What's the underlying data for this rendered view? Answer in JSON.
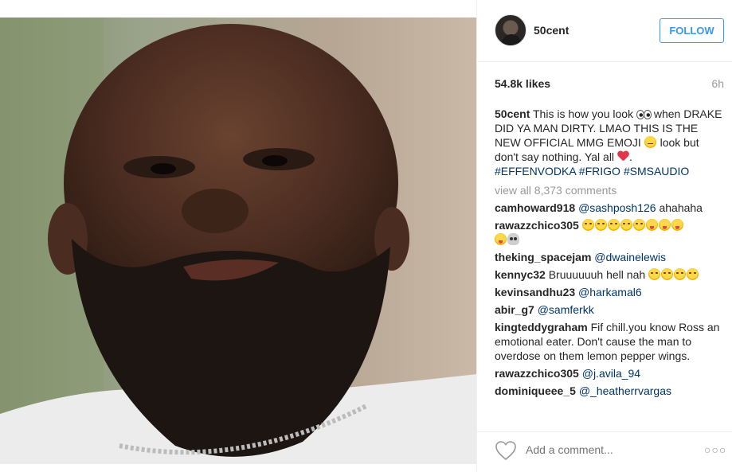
{
  "post": {
    "username": "50cent",
    "follow_label": "FOLLOW",
    "likes": "54.8k likes",
    "time": "6h",
    "caption": {
      "username": "50cent",
      "text_1": "This is how you look",
      "text_2": "when DRAKE DID YA MAN DIRTY. LMAO THIS IS THE NEW OFFICIAL MMG EMOJI",
      "text_3": "look but don't say nothing. Yal all",
      "text_4": ".",
      "hashtags": "#EFFENVODKA #FRIGO #SMSAUDIO"
    },
    "view_all": "view all 8,373 comments",
    "comments": [
      {
        "user": "camhoward918",
        "mention": "@sashposh126",
        "text": "ahahaha"
      },
      {
        "user": "rawazzchico305",
        "mention": "",
        "text": ""
      },
      {
        "user": "theking_spacejam",
        "mention": "@dwainelewis",
        "text": ""
      },
      {
        "user": "kennyc32",
        "mention": "",
        "text": "Bruuuuuuh hell nah"
      },
      {
        "user": "kevinsandhu23",
        "mention": "@harkamal6",
        "text": ""
      },
      {
        "user": "abir_g7",
        "mention": "@samferkk",
        "text": ""
      },
      {
        "user": "kingteddygraham",
        "mention": "",
        "text": "Fif chill.you know Ross an emotional eater. Don't cause the man to overdose on them lemon pepper wings."
      },
      {
        "user": "rawazzchico305",
        "mention": "@j.avila_94",
        "text": ""
      },
      {
        "user": "dominiqueee_5",
        "mention": "@_heatherrvargas",
        "text": ""
      }
    ],
    "add_comment_placeholder": "Add a comment...",
    "more_label": "○○○"
  },
  "icons": {
    "like": "heart-outline-icon",
    "more": "more-options-icon"
  },
  "colors": {
    "link": "#003569",
    "follow": "#3897f0",
    "muted": "#999999"
  }
}
